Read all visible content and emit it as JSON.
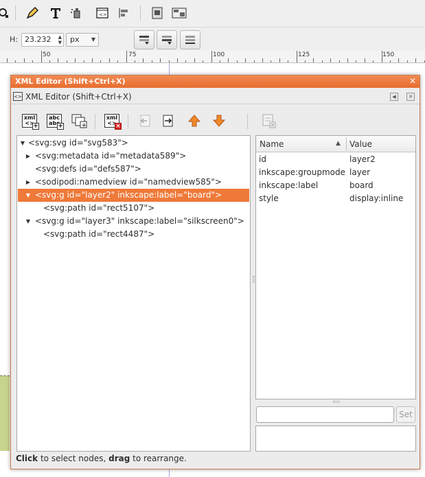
{
  "toolbar": {
    "icons": [
      "zoom-icon",
      "pen-icon",
      "text-icon",
      "spray-icon",
      "xml-editor-icon",
      "align-icon",
      "document-properties-icon",
      "symbols-icon"
    ]
  },
  "controls": {
    "h_label": "H:",
    "h_value": "23.232",
    "unit": "px"
  },
  "ruler": {
    "labels": [
      "50",
      "75",
      "100",
      "125",
      "150"
    ]
  },
  "dialog": {
    "window_title": "XML Editor (Shift+Ctrl+X)",
    "panel_title": "XML Editor (Shift+Ctrl+X)",
    "toolbar_buttons": [
      {
        "name": "new-element-node-button",
        "line1": "xml",
        "line2": "<>"
      },
      {
        "name": "new-text-node-button",
        "line1": "abc",
        "line2": "abc"
      },
      {
        "name": "duplicate-node-button",
        "line1": "",
        "line2": ""
      },
      {
        "name": "delete-node-button",
        "line1": "xml",
        "line2": "<>"
      },
      {
        "name": "unindent-node-button"
      },
      {
        "name": "indent-node-button"
      },
      {
        "name": "raise-node-button"
      },
      {
        "name": "lower-node-button"
      },
      {
        "name": "delete-attribute-button"
      }
    ]
  },
  "tree": {
    "nodes": [
      {
        "text": "<svg:svg id=\"svg583\">",
        "expander": "▼",
        "level": 0,
        "selected": false
      },
      {
        "text": "<svg:metadata id=\"metadata589\">",
        "expander": "▶",
        "level": 1,
        "selected": false
      },
      {
        "text": "<svg:defs id=\"defs587\">",
        "expander": "",
        "level": 1,
        "selected": false
      },
      {
        "text": "<sodipodi:namedview id=\"namedview585\">",
        "expander": "▶",
        "level": 1,
        "selected": false
      },
      {
        "text": "<svg:g id=\"layer2\" inkscape:label=\"board\">",
        "expander": "▼",
        "level": 1,
        "selected": true
      },
      {
        "text": "<svg:path id=\"rect5107\">",
        "expander": "",
        "level": 2,
        "selected": false
      },
      {
        "text": "<svg:g id=\"layer3\" inkscape:label=\"silkscreen0\">",
        "expander": "▼",
        "level": 1,
        "selected": false
      },
      {
        "text": "<svg:path id=\"rect4487\">",
        "expander": "",
        "level": 2,
        "selected": false
      }
    ]
  },
  "attributes": {
    "name_header": "Name",
    "value_header": "Value",
    "rows": [
      {
        "name": "id",
        "value": "layer2"
      },
      {
        "name": "inkscape:groupmode",
        "value": "layer"
      },
      {
        "name": "inkscape:label",
        "value": "board"
      },
      {
        "name": "style",
        "value": "display:inline"
      }
    ],
    "set_label": "Set"
  },
  "status": {
    "click": "Click",
    "mid": " to select nodes, ",
    "drag": "drag",
    "end": " to rearrange."
  },
  "colors": {
    "accent": "#ef7939",
    "titlebar": "#e86d2f"
  }
}
